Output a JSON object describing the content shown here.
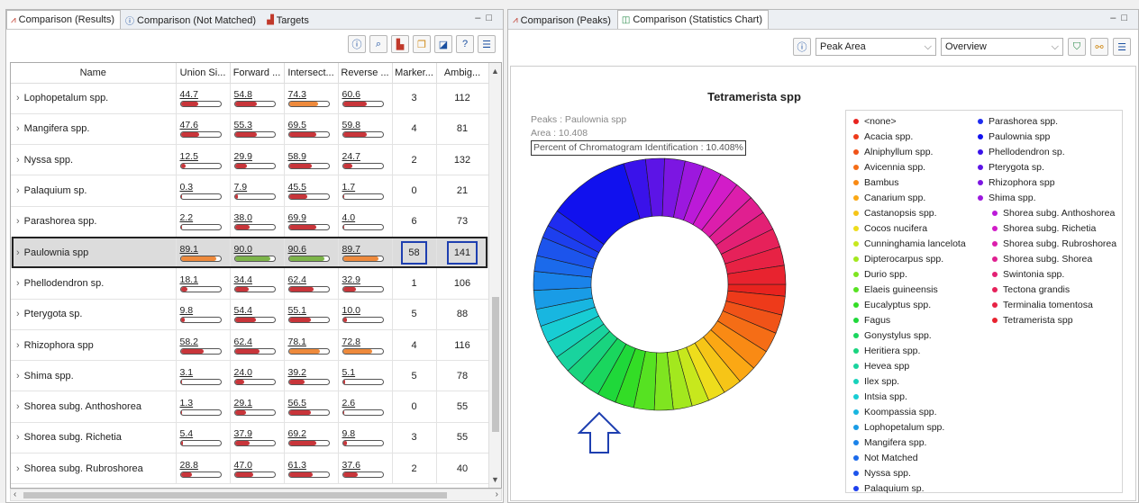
{
  "left_tabs": [
    {
      "label": "Comparison (Results)",
      "icon": "results-icon",
      "active": true
    },
    {
      "label": "Comparison (Not Matched)",
      "icon": "help-icon",
      "active": false
    },
    {
      "label": "Targets",
      "icon": "targets-icon",
      "active": false
    }
  ],
  "right_tabs": [
    {
      "label": "Comparison (Peaks)",
      "icon": "peaks-icon",
      "active": false
    },
    {
      "label": "Comparison (Statistics Chart)",
      "icon": "chart-icon",
      "active": true
    }
  ],
  "table": {
    "columns": [
      "Name",
      "Union Si...",
      "Forward ...",
      "Intersect...",
      "Reverse ...",
      "Marker...",
      "Ambig..."
    ],
    "rows": [
      {
        "name": "Lophopetalum spp.",
        "metrics": [
          44.7,
          54.8,
          74.3,
          60.6
        ],
        "marker": "3",
        "ambig": "112"
      },
      {
        "name": "Mangifera spp.",
        "metrics": [
          47.6,
          55.3,
          69.5,
          59.8
        ],
        "marker": "4",
        "ambig": "81"
      },
      {
        "name": "Nyssa spp.",
        "metrics": [
          12.5,
          29.9,
          58.9,
          24.7
        ],
        "marker": "2",
        "ambig": "132"
      },
      {
        "name": "Palaquium sp.",
        "metrics": [
          0.3,
          7.9,
          45.5,
          1.7
        ],
        "marker": "0",
        "ambig": "21"
      },
      {
        "name": "Parashorea spp.",
        "metrics": [
          2.2,
          38.0,
          69.9,
          4.0
        ],
        "marker": "6",
        "ambig": "73"
      },
      {
        "name": "Paulownia spp",
        "metrics": [
          89.1,
          90.0,
          90.6,
          89.7
        ],
        "marker": "58",
        "ambig": "141",
        "selected": true
      },
      {
        "name": "Phellodendron sp.",
        "metrics": [
          18.1,
          34.4,
          62.4,
          32.9
        ],
        "marker": "1",
        "ambig": "106"
      },
      {
        "name": "Pterygota sp.",
        "metrics": [
          9.8,
          54.4,
          55.1,
          10.0
        ],
        "marker": "5",
        "ambig": "88"
      },
      {
        "name": "Rhizophora spp",
        "metrics": [
          58.2,
          62.4,
          78.1,
          72.8
        ],
        "marker": "4",
        "ambig": "116"
      },
      {
        "name": "Shima spp.",
        "metrics": [
          3.1,
          24.0,
          39.2,
          5.1
        ],
        "marker": "5",
        "ambig": "78"
      },
      {
        "name": "Shorea subg. Anthoshorea",
        "metrics": [
          1.3,
          29.1,
          56.5,
          2.6
        ],
        "marker": "0",
        "ambig": "55"
      },
      {
        "name": "Shorea subg. Richetia",
        "metrics": [
          5.4,
          37.9,
          69.2,
          9.8
        ],
        "marker": "3",
        "ambig": "55"
      },
      {
        "name": "Shorea subg. Rubroshorea",
        "metrics": [
          28.8,
          47.0,
          61.3,
          37.6
        ],
        "marker": "2",
        "ambig": "40"
      }
    ]
  },
  "bar_colors": {
    "low": "#c8353a",
    "mid": "#ee8a3c",
    "high": "#7db54a"
  },
  "right_toolbar": {
    "metric_select": "Peak Area",
    "view_select": "Overview"
  },
  "chart_data": {
    "type": "pie",
    "title": "Tetramerista spp",
    "tooltip": {
      "peaks": "Peaks : Paulownia spp",
      "area": "Area : 10.408",
      "percent": "Percent of Chromatogram Identification : 10.408%"
    },
    "slices": [
      {
        "label": "<none>",
        "color": "#e8231f",
        "value": 1.5
      },
      {
        "label": "Acacia spp.",
        "color": "#ee3a1a",
        "value": 2.4
      },
      {
        "label": "Alniphyllum spp.",
        "color": "#f05318",
        "value": 2.4
      },
      {
        "label": "Avicennia spp.",
        "color": "#f56d16",
        "value": 2.6
      },
      {
        "label": "Bambus",
        "color": "#f98a14",
        "value": 2.6
      },
      {
        "label": "Canarium spp.",
        "color": "#fba814",
        "value": 2.4
      },
      {
        "label": "Castanopsis spp.",
        "color": "#f6c517",
        "value": 2.4
      },
      {
        "label": "Cocos nucifera",
        "color": "#eedd1c",
        "value": 2.2
      },
      {
        "label": "Cunninghamia lancelota",
        "color": "#c7e81d",
        "value": 2.2
      },
      {
        "label": "Dipterocarpus spp.",
        "color": "#a3e81e",
        "value": 2.4
      },
      {
        "label": "Durio spp.",
        "color": "#7fe520",
        "value": 2.4
      },
      {
        "label": "Elaeis guineensis",
        "color": "#56e222",
        "value": 2.6
      },
      {
        "label": "Eucalyptus spp.",
        "color": "#33dd26",
        "value": 2.4
      },
      {
        "label": "Fagus",
        "color": "#1fd83a",
        "value": 2.4
      },
      {
        "label": "Gonystylus spp.",
        "color": "#1ad65e",
        "value": 2.4
      },
      {
        "label": "Heritiera spp.",
        "color": "#19d47f",
        "value": 2.4
      },
      {
        "label": "Hevea spp",
        "color": "#19d39e",
        "value": 2.2
      },
      {
        "label": "Ilex spp.",
        "color": "#18d2bb",
        "value": 2.2
      },
      {
        "label": "Intsia spp.",
        "color": "#18cdd4",
        "value": 2.2
      },
      {
        "label": "Koompassia spp.",
        "color": "#18b6e0",
        "value": 2.2
      },
      {
        "label": "Lophopetalum spp.",
        "color": "#199ce6",
        "value": 2.4
      },
      {
        "label": "Mangifera spp.",
        "color": "#1a83ea",
        "value": 2.4
      },
      {
        "label": "Not Matched",
        "color": "#1b6aeb",
        "value": 2.0
      },
      {
        "label": "Nyssa spp.",
        "color": "#1c54ec",
        "value": 2.4
      },
      {
        "label": "Palaquium sp.",
        "color": "#1d3fee",
        "value": 1.6
      },
      {
        "label": "Parashorea spp.",
        "color": "#1f2cf0",
        "value": 2.2
      },
      {
        "label": "Paulownia spp",
        "color": "#1111ee",
        "value": 10.408
      },
      {
        "label": "Phellodendron sp.",
        "color": "#3a12ea",
        "value": 2.8
      },
      {
        "label": "Pterygota sp.",
        "color": "#5c14e6",
        "value": 2.4
      },
      {
        "label": "Rhizophora spp",
        "color": "#7c16e2",
        "value": 2.6
      },
      {
        "label": "Shima spp.",
        "color": "#9c18de",
        "value": 2.4
      },
      {
        "label": "Shorea subg. Anthoshorea",
        "color": "#bb1ad8",
        "value": 2.4
      },
      {
        "label": "Shorea subg. Richetia",
        "color": "#d21cc8",
        "value": 2.4
      },
      {
        "label": "Shorea subg. Rubroshorea",
        "color": "#dc1eac",
        "value": 2.4
      },
      {
        "label": "Shorea subg. Shorea",
        "color": "#e01f90",
        "value": 2.4
      },
      {
        "label": "Swintonia spp.",
        "color": "#e32074",
        "value": 2.4
      },
      {
        "label": "Tectona grandis",
        "color": "#e6215a",
        "value": 2.4
      },
      {
        "label": "Terminalia tomentosa",
        "color": "#e72244",
        "value": 2.4
      },
      {
        "label": "Tetramerista spp",
        "color": "#e8232f",
        "value": 2.4
      }
    ],
    "legend_placement": "right",
    "highlight_arrow_target": "Paulownia spp"
  }
}
